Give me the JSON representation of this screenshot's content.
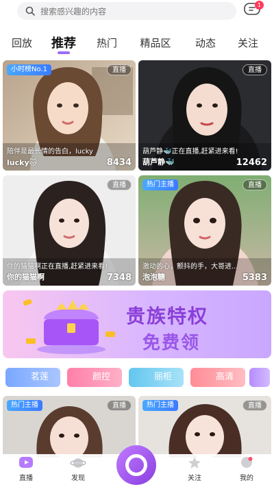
{
  "search": {
    "placeholder": "搜索感兴趣的内容"
  },
  "messages": {
    "badge_count": "1"
  },
  "tabs": [
    {
      "label": "回放"
    },
    {
      "label": "推荐"
    },
    {
      "label": "热门"
    },
    {
      "label": "精品区"
    },
    {
      "label": "动态"
    },
    {
      "label": "关注"
    }
  ],
  "cards": [
    {
      "tag": "小时榜No.1",
      "live": "直播",
      "desc": "陪伴是最长情的告白，lucky",
      "name": "lucky🐱",
      "count": "8434"
    },
    {
      "tag": "",
      "live": "直播",
      "desc": "葫芦静🐳正在直播,赶紧进来看!",
      "name": "葫芦静🐳",
      "count": "12462"
    },
    {
      "tag": "",
      "live": "直播",
      "desc": "你的猫猫啊正在直播,赶紧进来看!",
      "name": "你的猫猫啊",
      "count": "7348"
    },
    {
      "tag": "热门主播",
      "live": "直播",
      "desc": "激动的心，颤抖的手，大哥进...",
      "name": "泡泡糖",
      "count": "5383"
    },
    {
      "tag": "热门主播",
      "live": "直播"
    },
    {
      "tag": "热门主播",
      "live": "直播"
    }
  ],
  "banner": {
    "line1": "贵族特权",
    "line2": "免费领"
  },
  "chips": [
    {
      "label": "茗莲",
      "color": "#8bb6ff"
    },
    {
      "label": "颜控",
      "color": "#ff8fb6"
    },
    {
      "label": "丽柜",
      "color": "#7fd0f2"
    },
    {
      "label": "高清",
      "color": "#ff9fa6"
    }
  ],
  "bottom_nav": [
    {
      "label": "直播"
    },
    {
      "label": "发现"
    },
    {
      "label": "关注"
    },
    {
      "label": "我的"
    }
  ],
  "colors": {
    "accent": "#9b6bff",
    "tag_blue": "#3a7bff",
    "badge_red": "#ff3b5b"
  }
}
